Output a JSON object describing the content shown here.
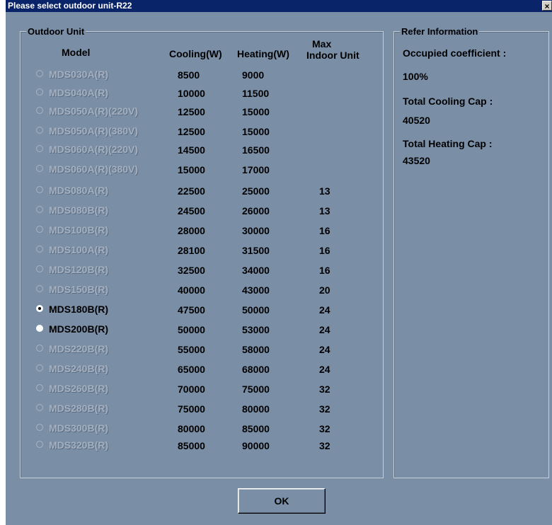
{
  "window": {
    "title": "Please select outdoor unit-R22",
    "close_label": "×"
  },
  "outdoor_unit": {
    "legend": "Outdoor Unit",
    "headers": {
      "model": "Model",
      "cooling": "Cooling(W)",
      "heating": "Heating(W)",
      "max_line1": "Max",
      "max_line2": "Indoor Unit"
    },
    "rows": [
      {
        "model": "MDS030A(R)",
        "cooling": "8500",
        "heating": "9000",
        "max": "",
        "enabled": false,
        "selected": false
      },
      {
        "model": "MDS040A(R)",
        "cooling": "10000",
        "heating": "11500",
        "max": "",
        "enabled": false,
        "selected": false
      },
      {
        "model": "MDS050A(R)(220V)",
        "cooling": "12500",
        "heating": "15000",
        "max": "",
        "enabled": false,
        "selected": false
      },
      {
        "model": "MDS050A(R)(380V)",
        "cooling": "12500",
        "heating": "15000",
        "max": "",
        "enabled": false,
        "selected": false
      },
      {
        "model": "MDS060A(R)(220V)",
        "cooling": "14500",
        "heating": "16500",
        "max": "",
        "enabled": false,
        "selected": false
      },
      {
        "model": "MDS060A(R)(380V)",
        "cooling": "15000",
        "heating": "17000",
        "max": "",
        "enabled": false,
        "selected": false
      },
      {
        "model": "MDS080A(R)",
        "cooling": "22500",
        "heating": "25000",
        "max": "13",
        "enabled": false,
        "selected": false
      },
      {
        "model": "MDS080B(R)",
        "cooling": "24500",
        "heating": "26000",
        "max": "13",
        "enabled": false,
        "selected": false
      },
      {
        "model": "MDS100B(R)",
        "cooling": "28000",
        "heating": "30000",
        "max": "16",
        "enabled": false,
        "selected": false
      },
      {
        "model": "MDS100A(R)",
        "cooling": "28100",
        "heating": "31500",
        "max": "16",
        "enabled": false,
        "selected": false
      },
      {
        "model": "MDS120B(R)",
        "cooling": "32500",
        "heating": "34000",
        "max": "16",
        "enabled": false,
        "selected": false
      },
      {
        "model": "MDS150B(R)",
        "cooling": "40000",
        "heating": "43000",
        "max": "20",
        "enabled": false,
        "selected": false
      },
      {
        "model": "MDS180B(R)",
        "cooling": "47500",
        "heating": "50000",
        "max": "24",
        "enabled": true,
        "selected": true
      },
      {
        "model": "MDS200B(R)",
        "cooling": "50000",
        "heating": "53000",
        "max": "24",
        "enabled": true,
        "selected": false
      },
      {
        "model": "MDS220B(R)",
        "cooling": "55000",
        "heating": "58000",
        "max": "24",
        "enabled": false,
        "selected": false
      },
      {
        "model": "MDS240B(R)",
        "cooling": "65000",
        "heating": "68000",
        "max": "24",
        "enabled": false,
        "selected": false
      },
      {
        "model": "MDS260B(R)",
        "cooling": "70000",
        "heating": "75000",
        "max": "32",
        "enabled": false,
        "selected": false
      },
      {
        "model": "MDS280B(R)",
        "cooling": "75000",
        "heating": "80000",
        "max": "32",
        "enabled": false,
        "selected": false
      },
      {
        "model": "MDS300B(R)",
        "cooling": "80000",
        "heating": "85000",
        "max": "32",
        "enabled": false,
        "selected": false
      },
      {
        "model": "MDS320B(R)",
        "cooling": "85000",
        "heating": "90000",
        "max": "32",
        "enabled": false,
        "selected": false
      }
    ]
  },
  "refer_info": {
    "legend": "Refer Information",
    "occupied_label": "Occupied coefficient :",
    "occupied_value": "100%",
    "total_cooling_label": "Total Cooling Cap :",
    "total_cooling_value": "40520",
    "total_heating_label": "Total Heating Cap :",
    "total_heating_value": "43520"
  },
  "buttons": {
    "ok_label": "OK"
  },
  "colors": {
    "window_bg": "#7a8ea6",
    "titlebar_bg": "#0a246a",
    "disabled_text": "#a4b0c0"
  }
}
